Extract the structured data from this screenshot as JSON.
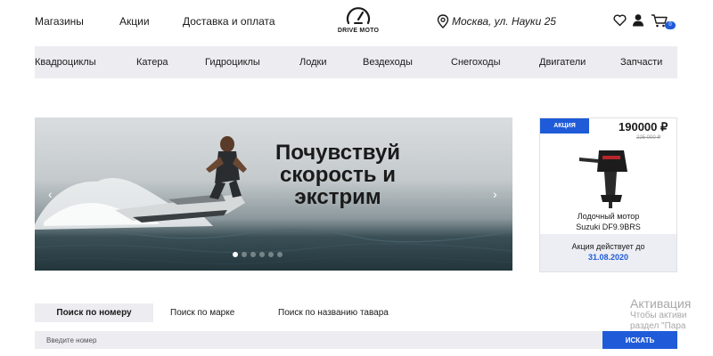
{
  "header": {
    "links": [
      "Магазины",
      "Акции",
      "Доставка и оплата"
    ],
    "logo_text": "DRIVE MOTO",
    "location": "Москва, ул. Науки 25",
    "cart_count": "0"
  },
  "categories": [
    "Квадроциклы",
    "Катера",
    "Гидроциклы",
    "Лодки",
    "Вездеходы",
    "Снегоходы",
    "Двигатели",
    "Запчасти"
  ],
  "hero": {
    "headline": [
      "Почувствуй",
      "скорость и",
      "экстрим"
    ],
    "prev_arrow": "‹",
    "next_arrow": "›",
    "slides_total": 6,
    "active_slide": 1
  },
  "promo": {
    "badge": "АКЦИЯ",
    "price": "190000 ₽",
    "old_price": "225 000 ₽",
    "product_name": [
      "Лодочный мотор",
      "Suzuki DF9.9BRS"
    ],
    "offer_text": "Акция действует до",
    "offer_date": "31.08.2020"
  },
  "search": {
    "tabs": [
      "Поиск по номеру",
      "Поиск по марке",
      "Поиск по названию тавара"
    ],
    "active_tab": 0,
    "placeholder": "Введите номер",
    "value": "",
    "button_label": "ИСКАТЬ"
  },
  "watermark": {
    "title": "Активация",
    "line1": "Чтобы активи",
    "line2": "раздел \"Пара"
  },
  "colors": {
    "accent": "#1f5bd8",
    "panel_bg": "#ececf1"
  }
}
